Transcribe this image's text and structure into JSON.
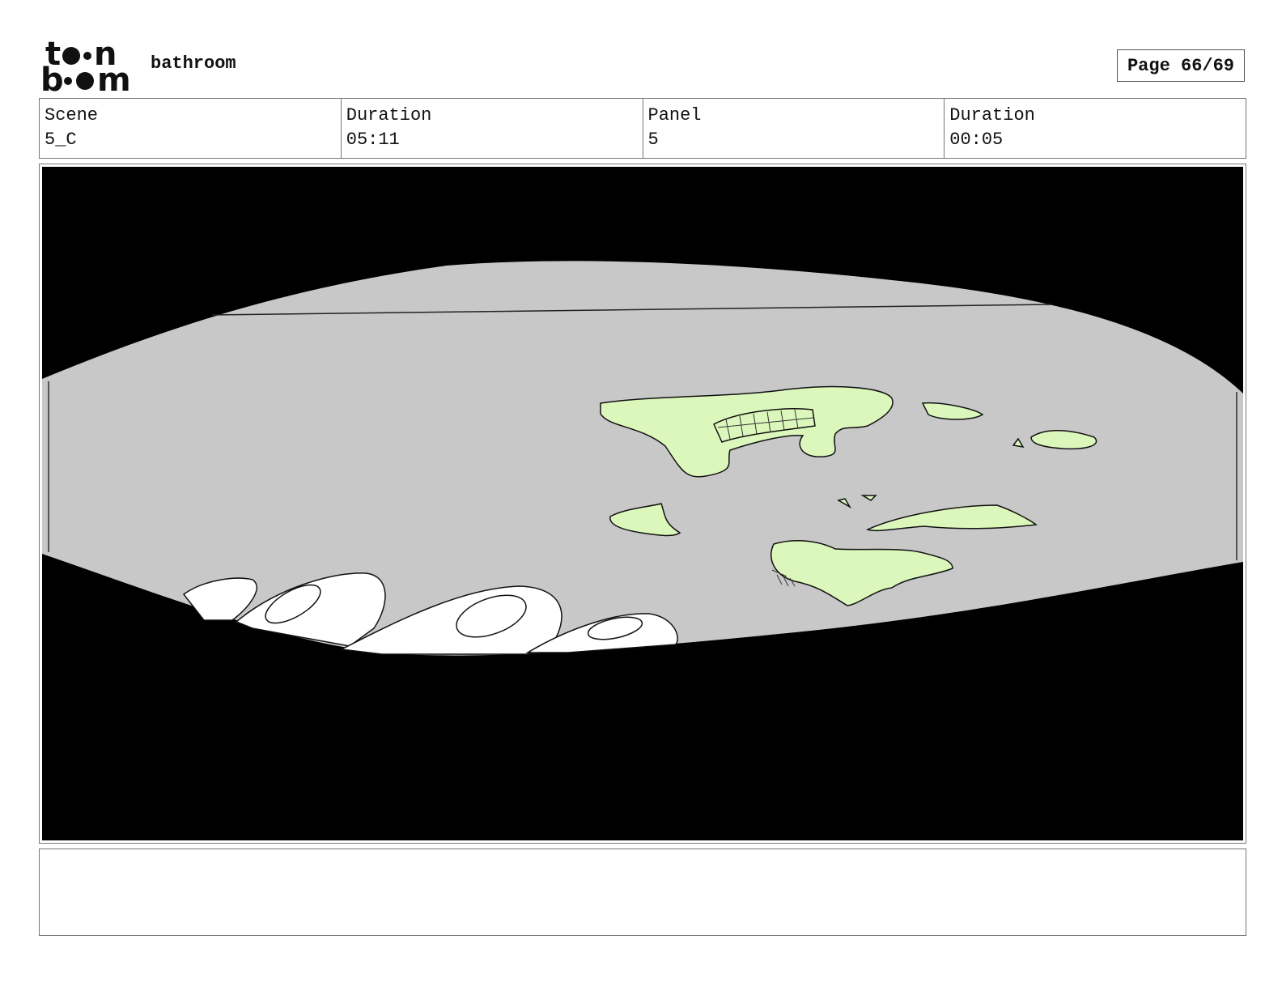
{
  "header": {
    "logo_top": "t••n",
    "logo_bottom": "b••m",
    "title": "bathroom",
    "page": "Page 66/69"
  },
  "info": {
    "scene_label": "Scene",
    "scene_value": "5_C",
    "duration1_label": "Duration",
    "duration1_value": "05:11",
    "panel_label": "Panel",
    "panel_value": "5",
    "duration2_label": "Duration",
    "duration2_value": "00:05"
  },
  "panel": {
    "colors": {
      "background": "#000000",
      "floor": "#c8c8c8",
      "slime": "#dcf7bb",
      "fingers": "#ffffff",
      "outline": "#111111"
    }
  },
  "notes": {
    "text": ""
  }
}
